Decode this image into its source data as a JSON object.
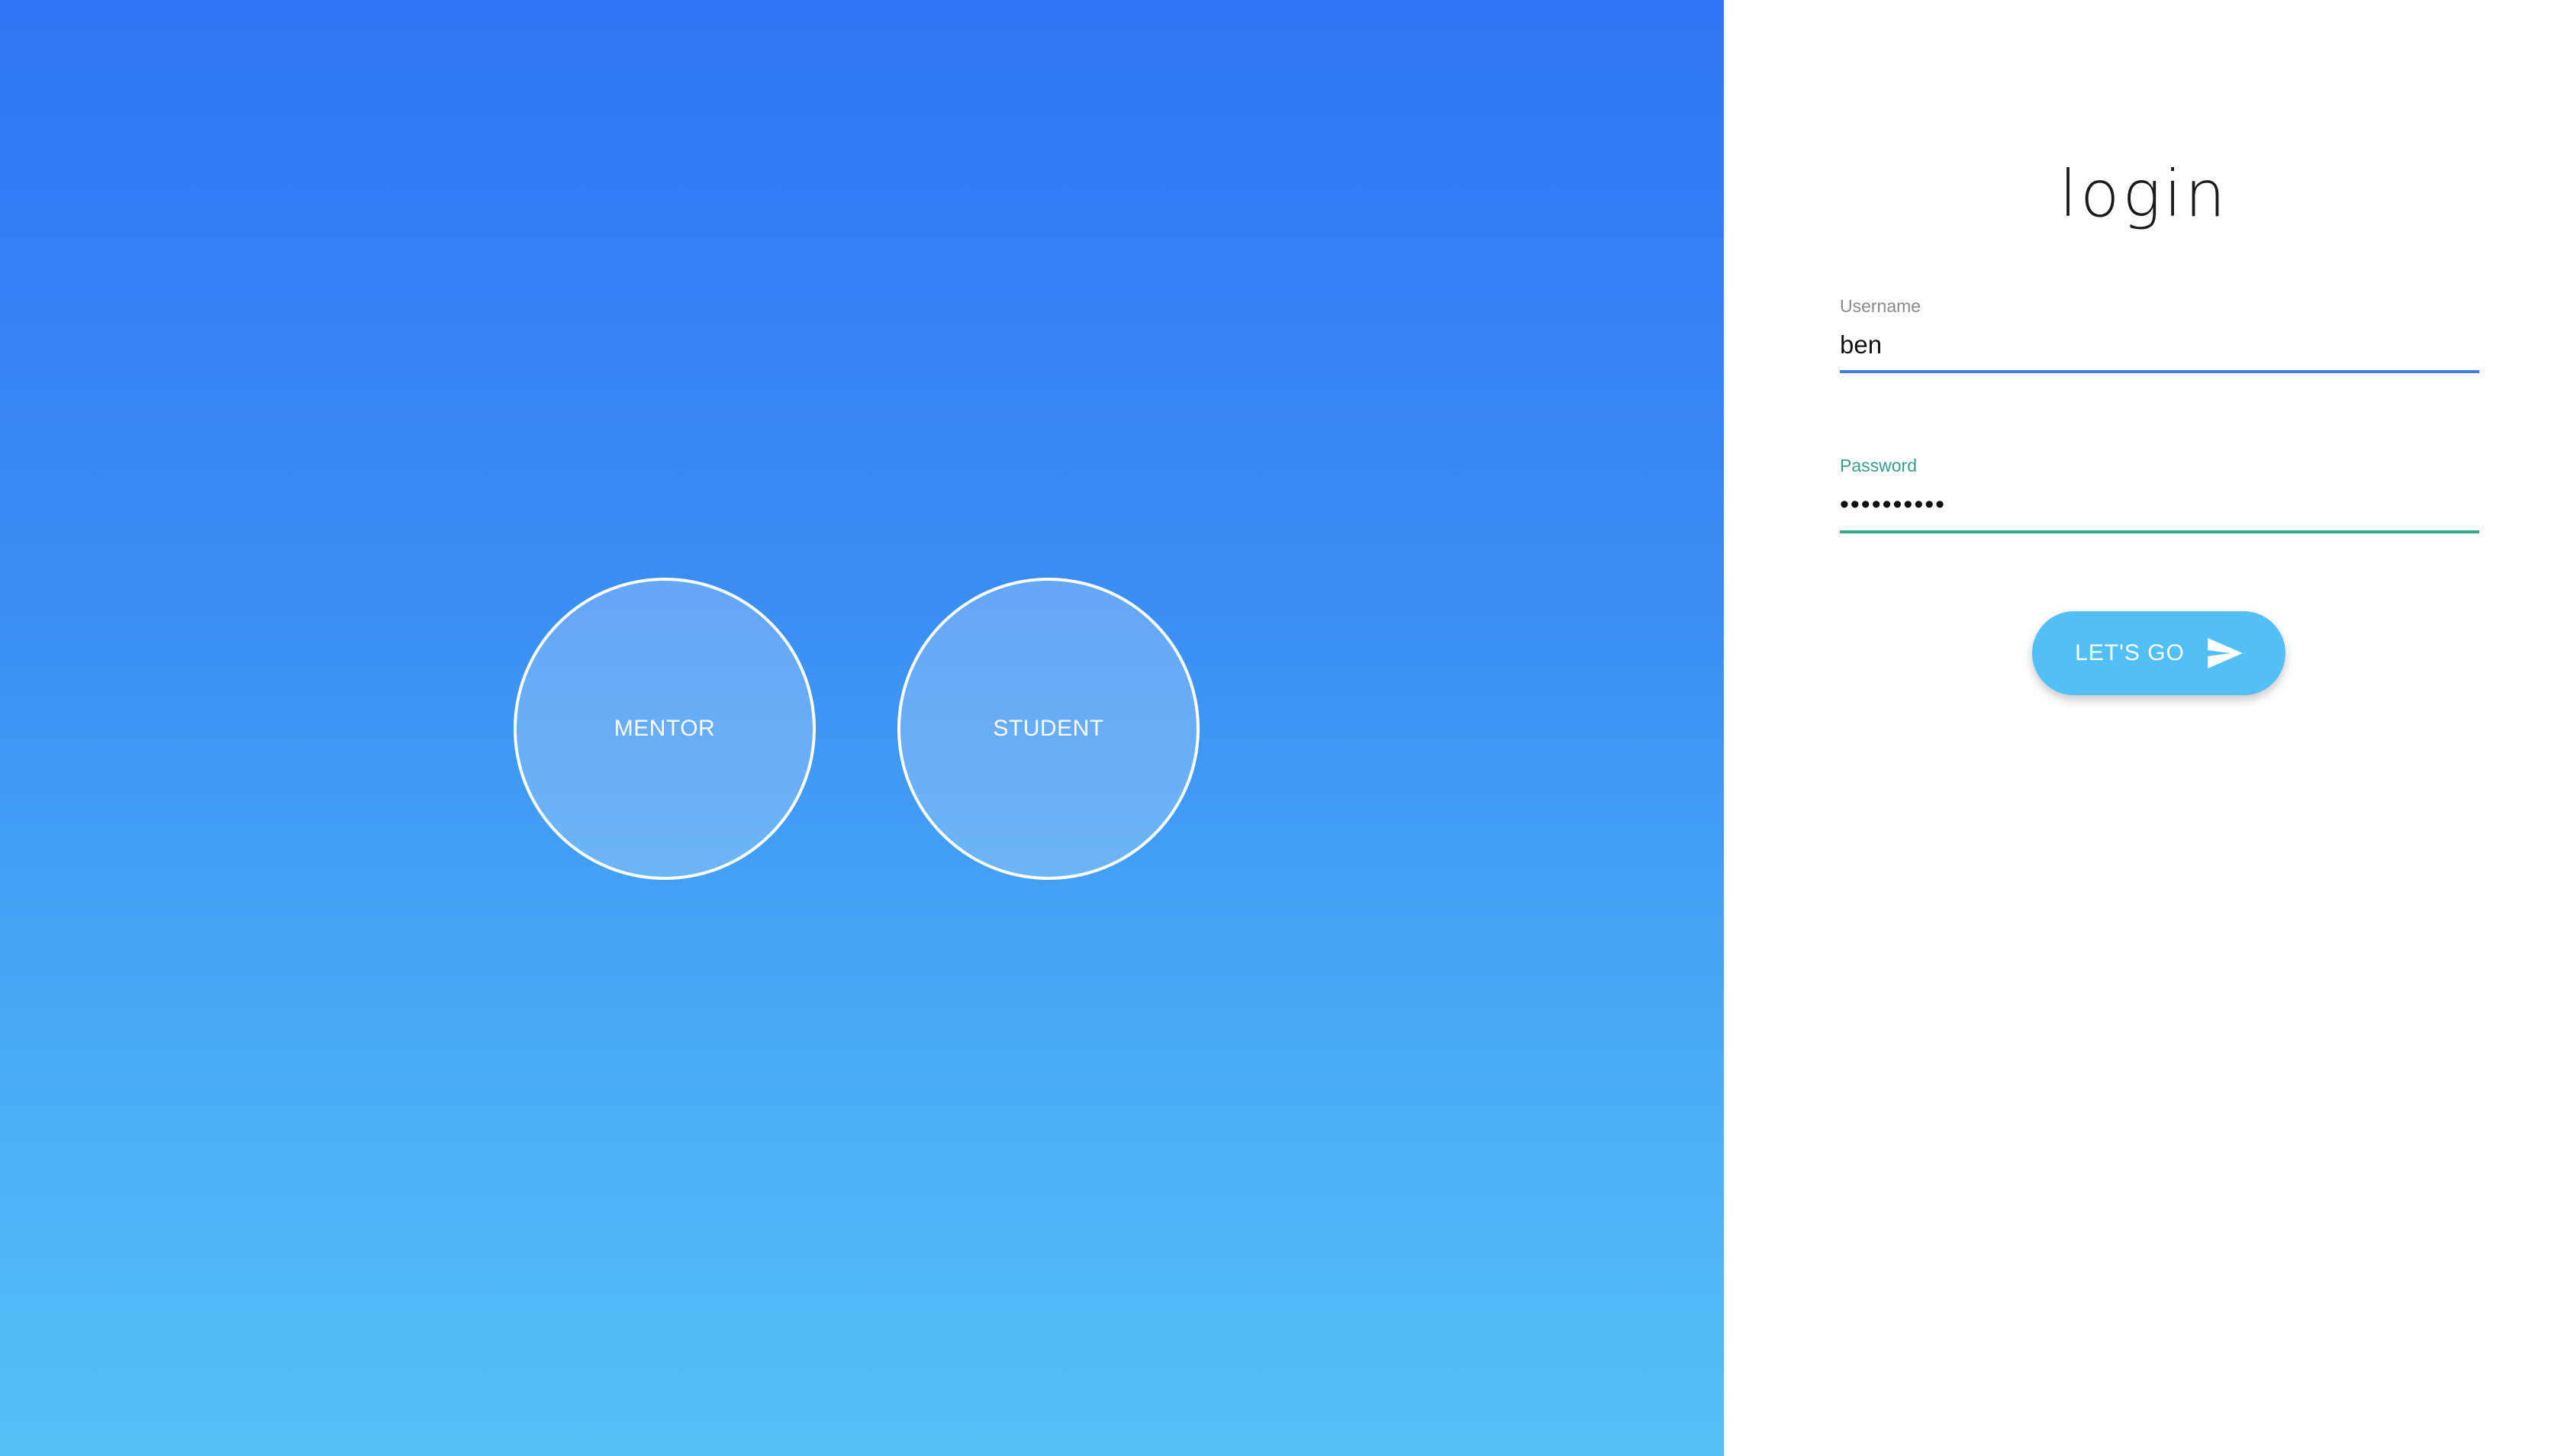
{
  "roles": {
    "mentor_label": "MENTOR",
    "student_label": "STUDENT"
  },
  "login": {
    "title": "login",
    "username_label": "Username",
    "username_value": "ben",
    "password_label": "Password",
    "password_value": "••••••••••",
    "submit_label": "LET'S GO",
    "submit_icon": "send-icon"
  },
  "colors": {
    "gradient_top": "#2f76f6",
    "gradient_bottom": "#54c1f8",
    "button_bg": "#52c0f6",
    "username_underline": "#3f7fe3",
    "password_underline": "#3aa890"
  }
}
